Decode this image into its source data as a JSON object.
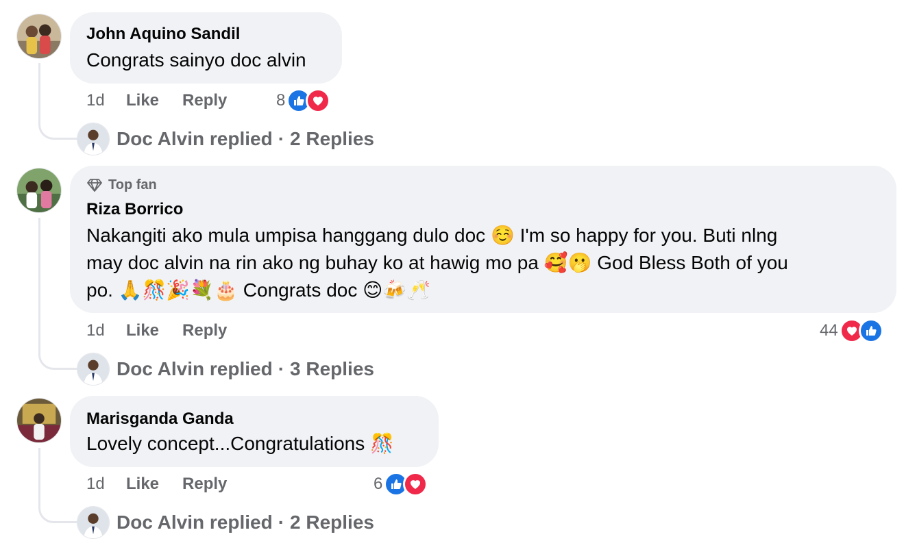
{
  "comments": [
    {
      "author": "John Aquino Sandil",
      "badge": "",
      "lines": [
        "Congrats sainyo doc alvin"
      ],
      "time": "1d",
      "like_label": "Like",
      "reply_label": "Reply",
      "reaction_count": "8",
      "reactions": [
        "like",
        "love"
      ],
      "replied_by": "Doc Alvin replied",
      "separator": "·",
      "replies_label": "2 Replies"
    },
    {
      "author": "Riza Borrico",
      "badge": "Top fan",
      "lines": [
        "Nakangiti ako mula umpisa hanggang dulo doc ☺️ I'm so happy for you. Buti nlng",
        "may doc alvin na rin ako ng buhay ko at hawig mo pa 🥰🫢 God Bless Both of you",
        "po. 🙏🎊🎉💐🎂 Congrats doc 😊🍻🥂"
      ],
      "time": "1d",
      "like_label": "Like",
      "reply_label": "Reply",
      "reaction_count": "44",
      "reactions": [
        "love",
        "like"
      ],
      "replied_by": "Doc Alvin replied",
      "separator": "·",
      "replies_label": "3 Replies"
    },
    {
      "author": "Marisganda Ganda",
      "badge": "",
      "lines": [
        "Lovely concept...Congratulations 🎊"
      ],
      "time": "1d",
      "like_label": "Like",
      "reply_label": "Reply",
      "reaction_count": "6",
      "reactions": [
        "like",
        "love"
      ],
      "replied_by": "Doc Alvin replied",
      "separator": "·",
      "replies_label": "2 Replies"
    }
  ],
  "colors": {
    "bubble": "#f0f2f5",
    "meta": "#65676b",
    "like": "#1b74e4",
    "love": "#f0284a"
  }
}
